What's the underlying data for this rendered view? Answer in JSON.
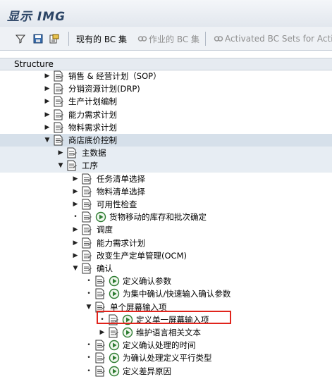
{
  "title": "显示 IMG",
  "toolbar": {
    "current_bc_set": "现有的 BC 集",
    "bc_set_activity": "作业的 BC 集",
    "activated_bc_sets": "Activated BC Sets for Activi"
  },
  "structure_header": "Structure",
  "colors": {
    "highlight_border": "#e0241c",
    "section_bg": "#dde6ee",
    "title_text": "#2c4566"
  },
  "tree": [
    {
      "label": "销售 & 经营计划（SOP）",
      "level": 0,
      "expander": "collapsed",
      "exec": false,
      "band": "none"
    },
    {
      "label": "分销资源计划(DRP)",
      "level": 0,
      "expander": "collapsed",
      "exec": false,
      "band": "none"
    },
    {
      "label": "生产计划编制",
      "level": 0,
      "expander": "collapsed",
      "exec": false,
      "band": "none"
    },
    {
      "label": "能力需求计划",
      "level": 0,
      "expander": "collapsed",
      "exec": false,
      "band": "none"
    },
    {
      "label": "物料需求计划",
      "level": 0,
      "expander": "collapsed",
      "exec": false,
      "band": "none"
    },
    {
      "label": "商店底价控制",
      "level": 0,
      "expander": "expanded",
      "exec": false,
      "band": "dark"
    },
    {
      "label": "主数据",
      "level": 1,
      "expander": "collapsed",
      "exec": false,
      "band": "light"
    },
    {
      "label": "工序",
      "level": 1,
      "expander": "expanded",
      "exec": false,
      "band": "light"
    },
    {
      "label": "任务清单选择",
      "level": 2,
      "expander": "collapsed",
      "exec": false,
      "band": "none"
    },
    {
      "label": "物料清单选择",
      "level": 2,
      "expander": "collapsed",
      "exec": false,
      "band": "none"
    },
    {
      "label": "可用性检查",
      "level": 2,
      "expander": "collapsed",
      "exec": false,
      "band": "none"
    },
    {
      "label": "货物移动的库存和批次确定",
      "level": 2,
      "expander": "leaf",
      "exec": true,
      "band": "none"
    },
    {
      "label": "调度",
      "level": 2,
      "expander": "collapsed",
      "exec": false,
      "band": "none"
    },
    {
      "label": "能力需求计划",
      "level": 2,
      "expander": "collapsed",
      "exec": false,
      "band": "none"
    },
    {
      "label": "改变生产定单管理(OCM)",
      "level": 2,
      "expander": "collapsed",
      "exec": false,
      "band": "none"
    },
    {
      "label": "确认",
      "level": 2,
      "expander": "expanded",
      "exec": false,
      "band": "none"
    },
    {
      "label": "定义确认参数",
      "level": 3,
      "expander": "leaf",
      "exec": true,
      "band": "none"
    },
    {
      "label": "为集中确认/快速输入确认参数",
      "level": 3,
      "expander": "leaf",
      "exec": true,
      "band": "none"
    },
    {
      "label": "单个屏幕输入项",
      "level": 3,
      "expander": "expanded",
      "exec": false,
      "band": "none"
    },
    {
      "label": "定义单一屏幕输入项",
      "level": 4,
      "expander": "leaf",
      "exec": true,
      "band": "none",
      "selected": true
    },
    {
      "label": "维护语言相关文本",
      "level": 4,
      "expander": "collapsed",
      "exec": true,
      "band": "none"
    },
    {
      "label": "定义确认处理的时间",
      "level": 3,
      "expander": "leaf",
      "exec": true,
      "band": "none"
    },
    {
      "label": "为确认处理定义平行类型",
      "level": 3,
      "expander": "leaf",
      "exec": true,
      "band": "none"
    },
    {
      "label": "定义差异原因",
      "level": 3,
      "expander": "leaf",
      "exec": true,
      "band": "none"
    }
  ]
}
